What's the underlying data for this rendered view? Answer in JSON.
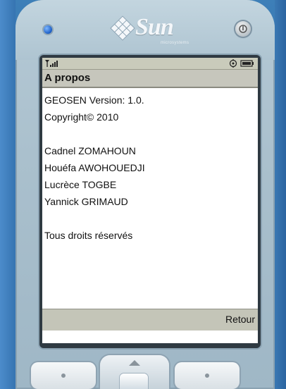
{
  "device": {
    "brand_name": "Sun",
    "brand_subtitle": "microsystems",
    "colors": {
      "background_blue": "#2f6aa6",
      "phone_body": "#aac0cd",
      "status_bar": "#c9cbbb",
      "title_bar": "#c6c6bc",
      "soft_bar": "#c4c5b8",
      "led": "#1a5cc4"
    },
    "icons": [
      "led-indicator",
      "power-icon",
      "sun-logo-icon",
      "signal-icon",
      "settings-icon",
      "battery-icon",
      "nav-up-arrow-icon"
    ]
  },
  "screen": {
    "title": "A propos",
    "lines": {
      "version": "GEOSEN Version: 1.0.",
      "copyright": "Copyright© 2010",
      "author1": "Cadnel ZOMAHOUN",
      "author2": "Houéfa AWOHOUEDJI",
      "author3": "Lucrèce TOGBE",
      "author4": "Yannick GRIMAUD",
      "rights": "Tous droits réservés"
    },
    "softkey_right": "Retour"
  }
}
